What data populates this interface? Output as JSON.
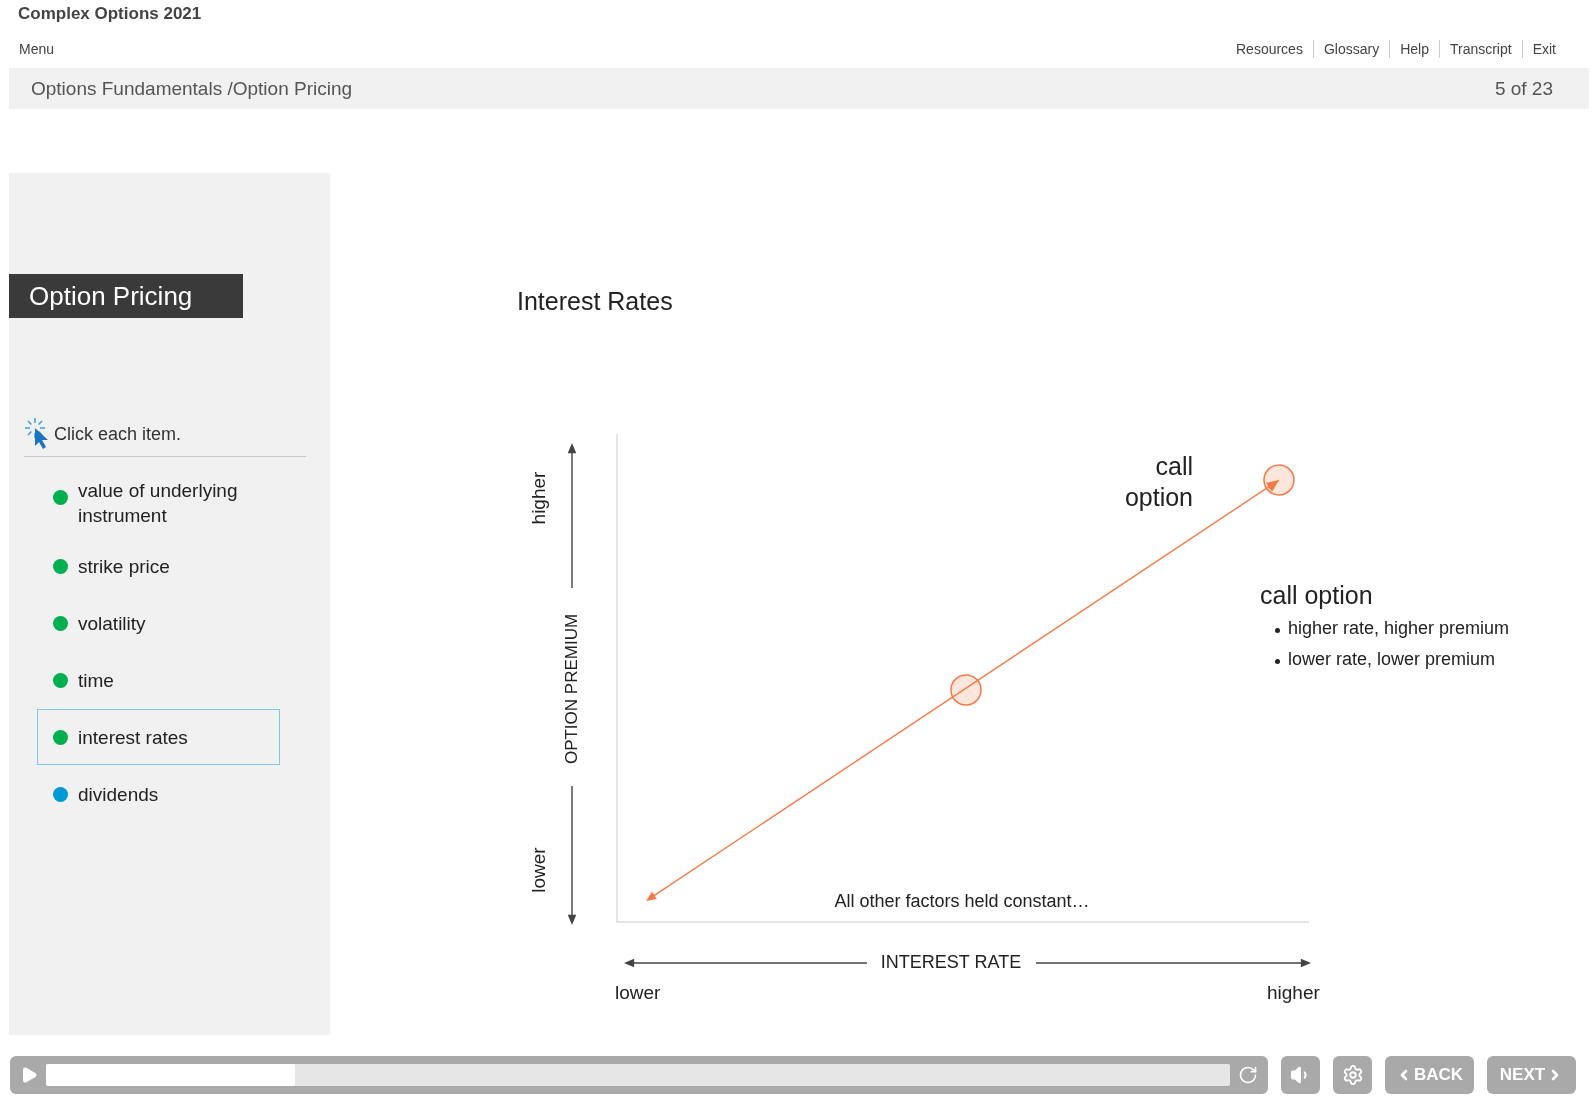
{
  "header": {
    "title": "Complex Options 2021",
    "menu": "Menu",
    "links": [
      "Resources",
      "Glossary",
      "Help",
      "Transcript",
      "Exit"
    ]
  },
  "breadcrumb": {
    "path": "Options Fundamentals /Option Pricing",
    "page": "5 of 23"
  },
  "sidebar": {
    "banner": "Option Pricing",
    "instruction": "Click each item.",
    "items": [
      {
        "label": "value of underlying instrument",
        "color": "#00b050",
        "selected": false
      },
      {
        "label": "strike price",
        "color": "#00b050",
        "selected": false
      },
      {
        "label": "volatility",
        "color": "#00b050",
        "selected": false
      },
      {
        "label": "time",
        "color": "#00b050",
        "selected": false
      },
      {
        "label": "interest rates",
        "color": "#00b050",
        "selected": true
      },
      {
        "label": "dividends",
        "color": "#0099d8",
        "selected": false
      }
    ]
  },
  "slide": {
    "title": "Interest Rates",
    "diagram": {
      "y_axis_label": "OPTION PREMIUM",
      "y_high": "higher",
      "y_low": "lower",
      "x_axis_label": "INTEREST RATE",
      "x_low": "lower",
      "x_high": "higher",
      "line_label": "call option",
      "note": "All other factors held constant…",
      "callout": {
        "title": "call option",
        "bullets": [
          "higher rate, higher premium",
          "lower rate, lower premium"
        ]
      }
    }
  },
  "player": {
    "level": 0.21,
    "buttons": [
      "BACK",
      "NEXT"
    ]
  }
}
